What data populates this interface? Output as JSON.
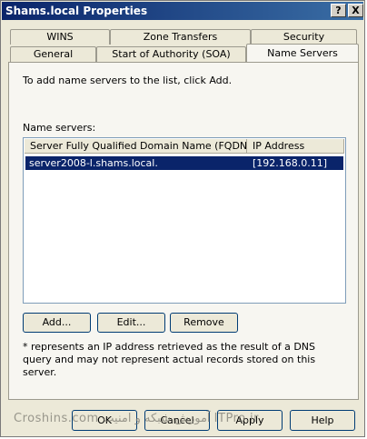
{
  "window": {
    "title": "Shams.local Properties",
    "help_button": "?",
    "close_button": "X"
  },
  "tabs_row_back": [
    {
      "label": "WINS"
    },
    {
      "label": "Zone Transfers"
    },
    {
      "label": "Security"
    }
  ],
  "tabs_row_front": [
    {
      "label": "General"
    },
    {
      "label": "Start of Authority (SOA)"
    },
    {
      "label": "Name Servers",
      "active": true
    }
  ],
  "panel": {
    "instruction": "To add name servers to the list, click Add.",
    "list_label": "Name servers:",
    "columns": [
      "Server Fully Qualified Domain Name (FQDN)",
      "IP Address"
    ],
    "rows": [
      {
        "fqdn": "server2008-l.shams.local.",
        "ip": "[192.168.0.11]",
        "selected": true
      }
    ],
    "buttons": {
      "add": "Add...",
      "edit": "Edit...",
      "remove": "Remove"
    },
    "note": "* represents an IP address retrieved as the result of a DNS query and may not represent actual records stored on this server."
  },
  "footer": {
    "ok": "OK",
    "cancel": "Cancel",
    "apply": "Apply",
    "help": "Help"
  },
  "watermark": "Croshins.com  آموزش شبکه و امنیت  ITPro.ir",
  "colors": {
    "titlebar": "#0a246a",
    "selection": "#0a246a",
    "dialog_bg": "#ece9d8"
  }
}
